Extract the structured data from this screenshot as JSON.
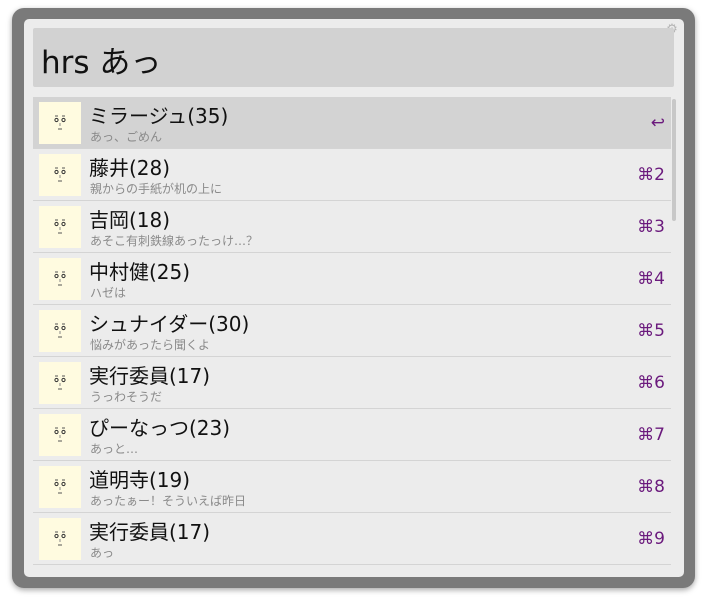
{
  "query": "hrs あっ",
  "icons": {
    "settings": "gear-icon",
    "thumbnail": "face-icon"
  },
  "colors": {
    "shortcut": "#6b1a7d",
    "selected_row": "#d3d3d3",
    "thumbnail_bg": "#fffbe0"
  },
  "results": [
    {
      "title": "ミラージュ(35)",
      "subtitle": "あっ、ごめん",
      "shortcut": "↩"
    },
    {
      "title": "藤井(28)",
      "subtitle": "親からの手紙が机の上に",
      "shortcut": "⌘2"
    },
    {
      "title": "吉岡(18)",
      "subtitle": "あそこ有刺鉄線あったっけ…？",
      "shortcut": "⌘3"
    },
    {
      "title": "中村健(25)",
      "subtitle": "ハゼは",
      "shortcut": "⌘4"
    },
    {
      "title": "シュナイダー(30)",
      "subtitle": "悩みがあったら聞くよ",
      "shortcut": "⌘5"
    },
    {
      "title": "実行委員(17)",
      "subtitle": "うっわそうだ",
      "shortcut": "⌘6"
    },
    {
      "title": "ぴーなっつ(23)",
      "subtitle": "あっと…",
      "shortcut": "⌘7"
    },
    {
      "title": "道明寺(19)",
      "subtitle": "あったぁー！そういえば昨日",
      "shortcut": "⌘8"
    },
    {
      "title": "実行委員(17)",
      "subtitle": "あっ",
      "shortcut": "⌘9"
    }
  ]
}
